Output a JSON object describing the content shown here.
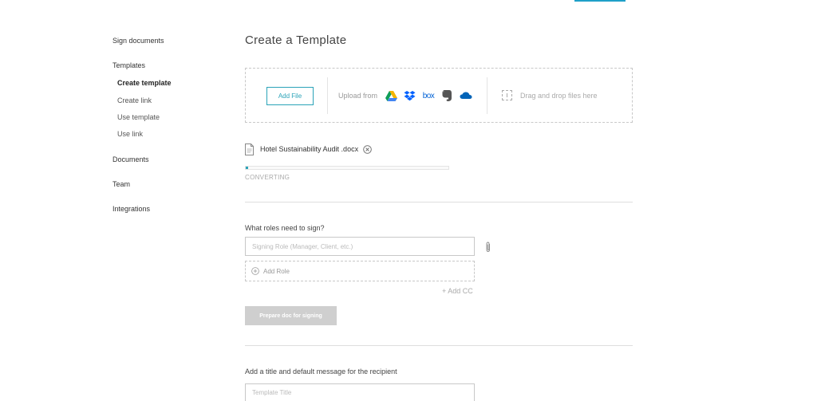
{
  "sidebar": {
    "items": [
      {
        "label": "Sign documents"
      },
      {
        "label": "Templates"
      },
      {
        "label": "Create template"
      },
      {
        "label": "Create link"
      },
      {
        "label": "Use template"
      },
      {
        "label": "Use link"
      },
      {
        "label": "Documents"
      },
      {
        "label": "Team"
      },
      {
        "label": "Integrations"
      }
    ],
    "active": "Create template"
  },
  "main": {
    "title": "Create a Template",
    "upload": {
      "add_file_label": "Add File",
      "upload_from_label": "Upload from",
      "services": [
        "google-drive-icon",
        "dropbox-icon",
        "box-icon",
        "evernote-icon",
        "onedrive-icon"
      ],
      "box_text": "box",
      "drag_drop_label": "Drag and drop files here"
    },
    "file": {
      "name": "Hotel Sustainability Audit .docx",
      "status": "CONVERTING",
      "progress": 0.01
    },
    "roles": {
      "label": "What roles need to sign?",
      "input_placeholder": "Signing Role (Manager, Client, etc.)",
      "input_value": "",
      "add_role_label": "Add Role",
      "add_cc_label": "+ Add CC"
    },
    "prepare_label": "Prepare doc for signing",
    "message": {
      "label": "Add a title and default message for the recipient",
      "title_placeholder": "Template Title"
    }
  },
  "colors": {
    "accent": "#2aa3b8",
    "google_drive_green": "#0f9d58",
    "google_drive_yellow": "#f4b400",
    "google_drive_blue": "#4285f4",
    "dropbox": "#0061fe",
    "box": "#0061d5",
    "evernote": "#555555",
    "onedrive": "#0364b8",
    "disabled_button": "#cfcfcf"
  }
}
